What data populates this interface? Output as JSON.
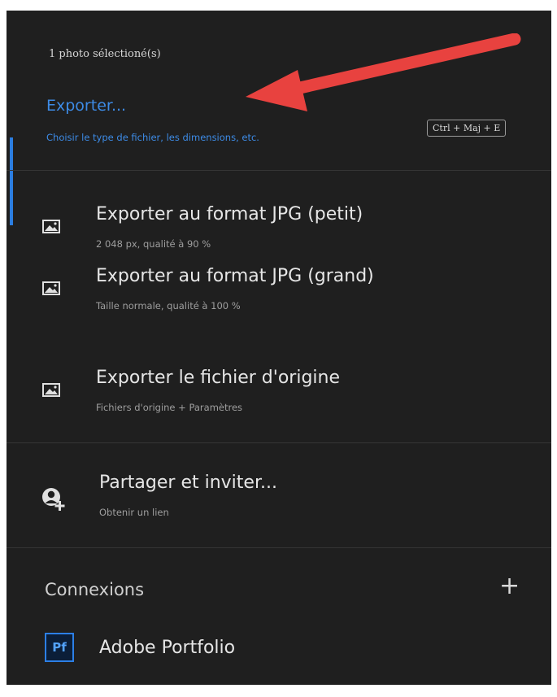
{
  "header": {
    "selection_count": "1 photo sélectioné(s)"
  },
  "export": {
    "title": "Exporter...",
    "subtitle": "Choisir le type de fichier, les dimensions, etc.",
    "shortcut": "Ctrl + Maj + E"
  },
  "export_items": [
    {
      "icon": "image-icon",
      "title": "Exporter au format JPG (petit)",
      "subtitle": "2 048 px, qualité à 90 %"
    },
    {
      "icon": "image-icon",
      "title": "Exporter au format JPG (grand)",
      "subtitle": "Taille normale, qualité à 100 %"
    },
    {
      "icon": "image-icon",
      "title": "Exporter le fichier d'origine",
      "subtitle": "Fichiers d'origine + Paramètres"
    }
  ],
  "share": {
    "icon": "add-person-icon",
    "title": "Partager et inviter...",
    "subtitle": "Obtenir un lien"
  },
  "connections": {
    "label": "Connexions",
    "add_icon": "plus-icon",
    "items": [
      {
        "badge": "Pf",
        "label": "Adobe Portfolio"
      }
    ]
  },
  "colors": {
    "panel_bg": "#1f1f1f",
    "accent": "#2b7de0",
    "annotation_arrow": "#e8423f"
  }
}
